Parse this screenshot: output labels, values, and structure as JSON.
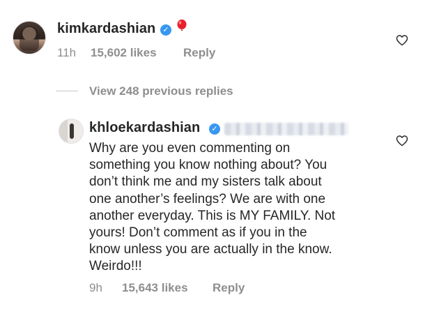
{
  "comment_main": {
    "username": "kimkardashian",
    "time": "11h",
    "likes": "15,602 likes",
    "reply_label": "Reply"
  },
  "view_replies_label": "View 248 previous replies",
  "comment_reply": {
    "username": "khloekardashian",
    "text": "Why are you even commenting on\nsomething you know nothing about? You\ndon’t think me and my sisters talk about\none another’s feelings? We are with one\nanother everyday. This is MY FAMILY. Not\nyours! Don’t comment as if you in the\nknow unless you are actually in the know.\nWeirdo!!!",
    "time": "9h",
    "likes": "15,643 likes",
    "reply_label": "Reply"
  },
  "icons": {
    "verified": "verified-badge-icon",
    "balloon": "red-balloon-emoji-icon",
    "heart": "heart-outline-icon"
  },
  "colors": {
    "verified_blue": "#3897f0",
    "text_primary": "#262626",
    "text_secondary": "#8e8e8e",
    "balloon_red": "#e8202b"
  }
}
